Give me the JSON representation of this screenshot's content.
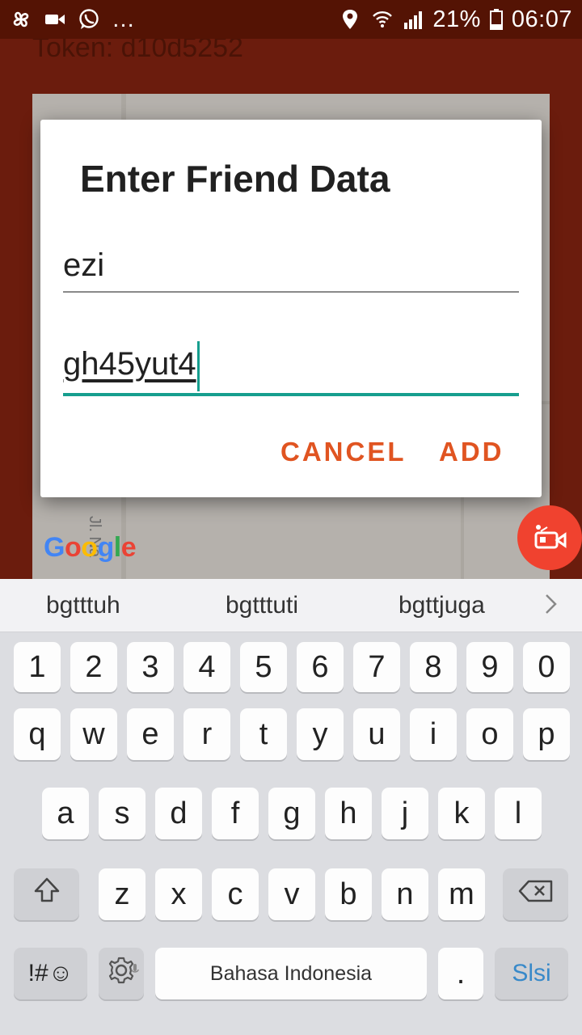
{
  "status_bar": {
    "battery": "21%",
    "time": "06:07"
  },
  "background": {
    "token_label": "Token: d10d5252",
    "map_brand": "Google",
    "street_label": "Jl. Na"
  },
  "dialog": {
    "title": "Enter Friend Data",
    "name_value": "ezi",
    "token_value": "gh45yut4",
    "cancel_label": "CANCEL",
    "add_label": "ADD"
  },
  "keyboard": {
    "suggestions": [
      "bgtttuh",
      "bgtttuti",
      "bgttjuga"
    ],
    "row_numbers": [
      "1",
      "2",
      "3",
      "4",
      "5",
      "6",
      "7",
      "8",
      "9",
      "0"
    ],
    "row_1": [
      "q",
      "w",
      "e",
      "r",
      "t",
      "y",
      "u",
      "i",
      "o",
      "p"
    ],
    "row_2": [
      "a",
      "s",
      "d",
      "f",
      "g",
      "h",
      "j",
      "k",
      "l"
    ],
    "row_3": [
      "z",
      "x",
      "c",
      "v",
      "b",
      "n",
      "m"
    ],
    "symbols_label": "!#☺",
    "space_label": "Bahasa Indonesia",
    "period_label": ".",
    "enter_label": "Slsi"
  },
  "colors": {
    "accent": "#e05421",
    "teal": "#169e8e",
    "record": "#f0422f"
  }
}
